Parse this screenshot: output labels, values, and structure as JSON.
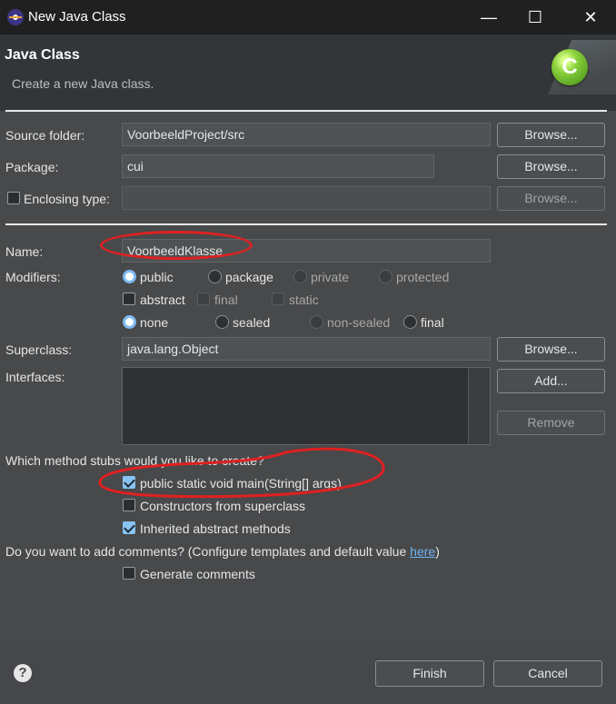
{
  "window": {
    "title": "New Java Class",
    "minimize_glyph": "—",
    "maximize_glyph": "☐",
    "close_glyph": "✕"
  },
  "header": {
    "title": "Java Class",
    "description": "Create a new Java class.",
    "icon_letter": "C"
  },
  "source_folder": {
    "label": "Source folder:",
    "value": "VoorbeeldProject/src",
    "browse": "Browse..."
  },
  "package": {
    "label": "Package:",
    "value": "cui",
    "browse": "Browse..."
  },
  "enclosing_type": {
    "label": "Enclosing type:",
    "value": "",
    "checked": false,
    "browse": "Browse..."
  },
  "name": {
    "label": "Name:",
    "value": "VoorbeeldKlasse"
  },
  "modifiers": {
    "label": "Modifiers:",
    "access": [
      {
        "label": "public",
        "checked": true,
        "enabled": true
      },
      {
        "label": "package",
        "checked": false,
        "enabled": true
      },
      {
        "label": "private",
        "checked": false,
        "enabled": false
      },
      {
        "label": "protected",
        "checked": false,
        "enabled": false
      }
    ],
    "flags": [
      {
        "label": "abstract",
        "checked": false
      },
      {
        "label": "final",
        "checked": false
      },
      {
        "label": "static",
        "checked": false
      }
    ],
    "sealing": [
      {
        "label": "none",
        "checked": true,
        "enabled": true
      },
      {
        "label": "sealed",
        "checked": false,
        "enabled": true
      },
      {
        "label": "non-sealed",
        "checked": false,
        "enabled": false
      },
      {
        "label": "final",
        "checked": false,
        "enabled": true
      }
    ]
  },
  "superclass": {
    "label": "Superclass:",
    "value": "java.lang.Object",
    "browse": "Browse..."
  },
  "interfaces": {
    "label": "Interfaces:",
    "add": "Add...",
    "remove": "Remove"
  },
  "method_stubs": {
    "question": "Which method stubs would you like to create?",
    "options": [
      {
        "label": "public static void main(String[] args)",
        "checked": true
      },
      {
        "label": "Constructors from superclass",
        "checked": false
      },
      {
        "label": "Inherited abstract methods",
        "checked": true
      }
    ]
  },
  "comments": {
    "question": "Do you want to add comments? (Configure templates and default value ",
    "link": "here",
    "question_end": ")",
    "option": {
      "label": "Generate comments",
      "checked": false
    }
  },
  "footer": {
    "help_glyph": "?",
    "finish": "Finish",
    "cancel": "Cancel"
  },
  "colors": {
    "background": "#47494b",
    "titlebar": "#202020",
    "annotation": "#e02020",
    "accent": "#89c3f2"
  }
}
